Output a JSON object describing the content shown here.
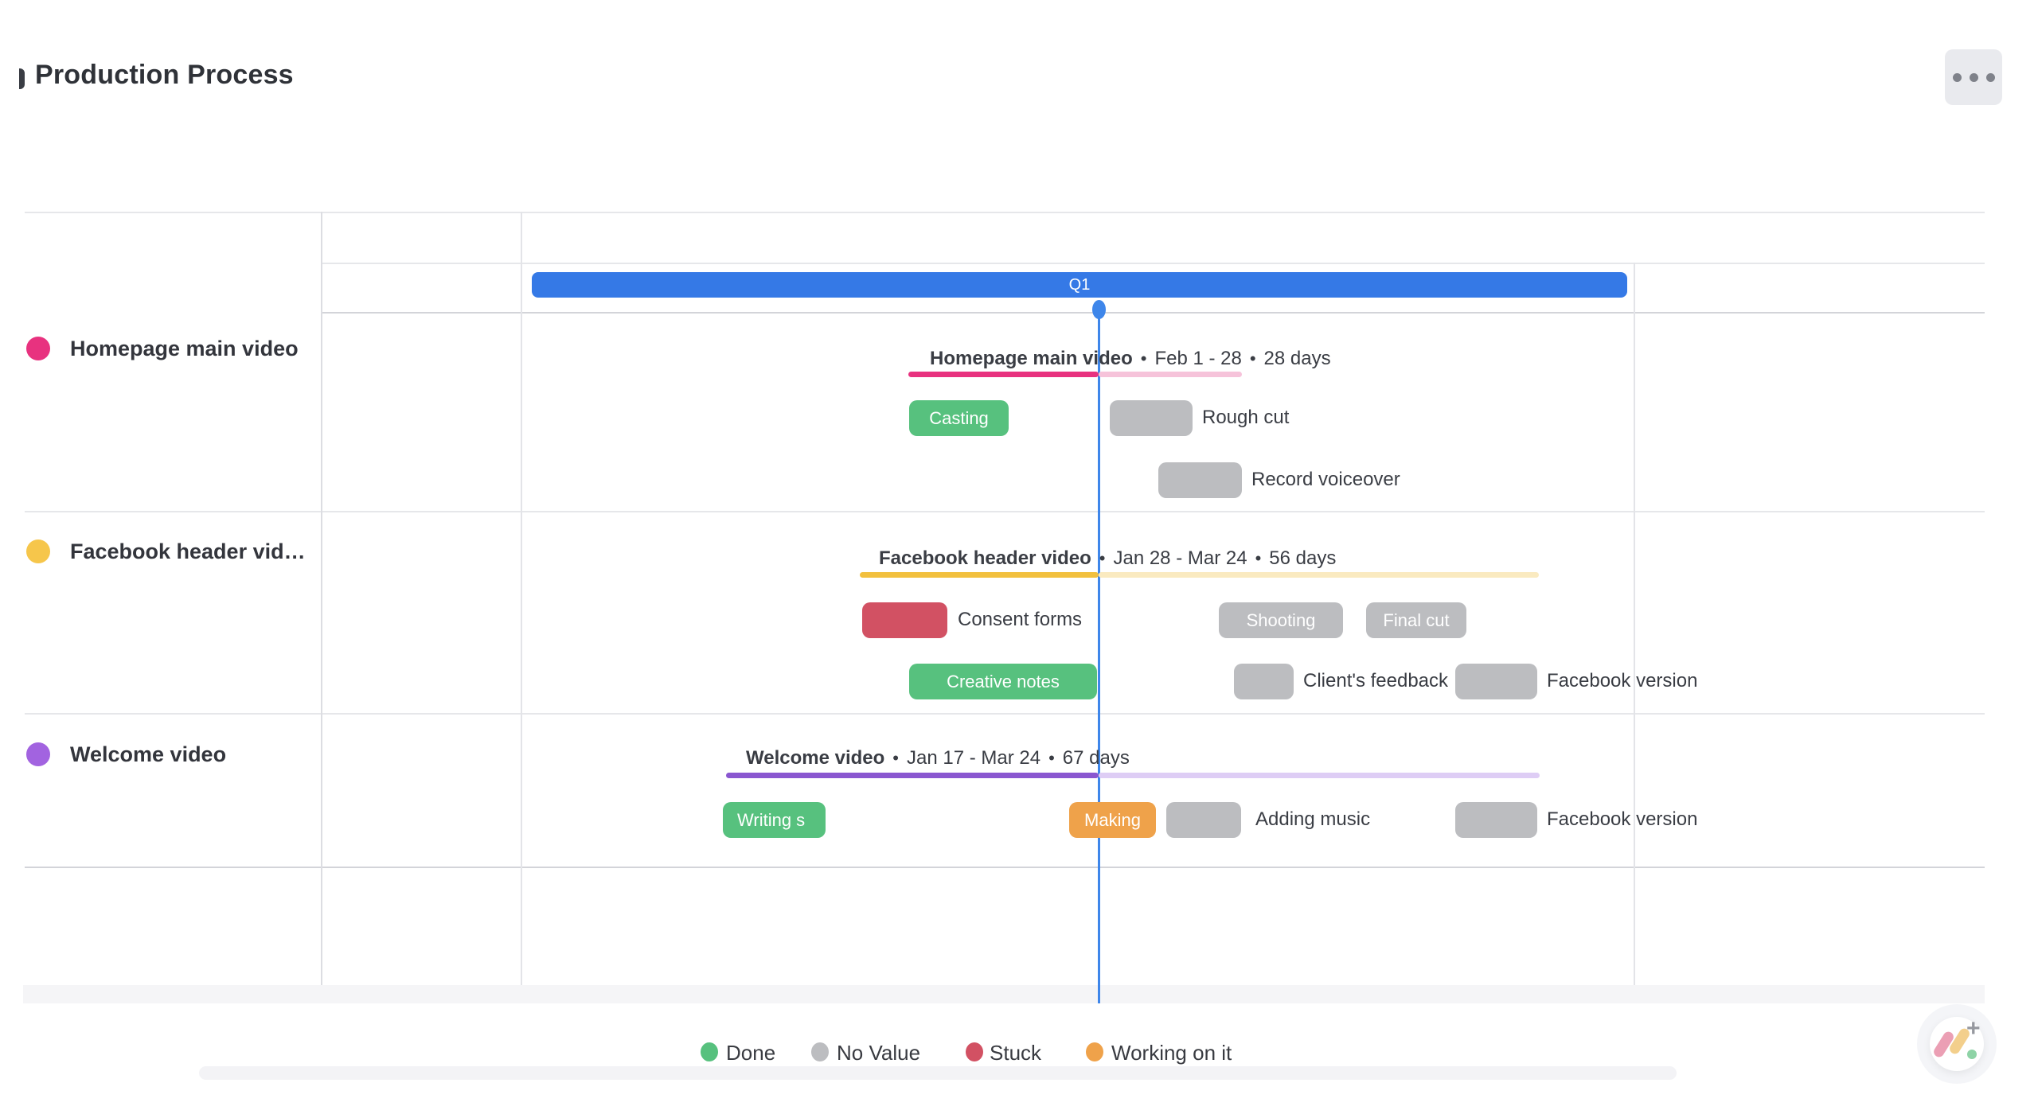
{
  "ui": {
    "bullet": "•"
  },
  "header": {
    "title": "Production Process",
    "menu_icon": "ellipsis-icon"
  },
  "timeline": {
    "quarter_label": "Q1"
  },
  "status_colors": {
    "done": "#57c17e",
    "no_value": "#bcbdc0",
    "stuck": "#d25163",
    "working_on_it": "#efa24a",
    "timeline_blue": "#3579e6",
    "today_line": "#3e86ea"
  },
  "rows": [
    {
      "sidebar_label": "Homepage main video",
      "color": "#e8327f",
      "group": {
        "name": "Homepage main video",
        "dates": "Feb 1 - 28",
        "duration": "28 days"
      },
      "tasks": [
        {
          "label": "Casting",
          "status": "done"
        },
        {
          "label": "Rough cut",
          "status": "no_value"
        },
        {
          "label": "Record voiceover",
          "status": "no_value"
        }
      ]
    },
    {
      "sidebar_label": "Facebook header vid…",
      "color": "#f6c64b",
      "group": {
        "name": "Facebook header video",
        "dates": "Jan 28 - Mar 24",
        "duration": "56 days"
      },
      "tasks": [
        {
          "label": "Consent forms",
          "status": "stuck"
        },
        {
          "label": "Shooting",
          "status": "no_value"
        },
        {
          "label": "Final cut",
          "status": "no_value"
        },
        {
          "label": "Creative notes",
          "status": "done"
        },
        {
          "label": "Client's feedback",
          "status": "no_value"
        },
        {
          "label": "Facebook version",
          "status": "no_value"
        }
      ]
    },
    {
      "sidebar_label": "Welcome video",
      "color": "#a263e0",
      "group": {
        "name": "Welcome video",
        "dates": "Jan 17 - Mar 24",
        "duration": "67 days"
      },
      "tasks": [
        {
          "label": "Writing s",
          "status": "done"
        },
        {
          "label": "Making",
          "status": "working_on_it"
        },
        {
          "label": "Adding music",
          "status": "no_value"
        },
        {
          "label": "Facebook version",
          "status": "no_value"
        }
      ]
    }
  ],
  "legend": {
    "items": [
      {
        "label": "Done",
        "color": "#57c17e"
      },
      {
        "label": "No Value",
        "color": "#bcbdc0"
      },
      {
        "label": "Stuck",
        "color": "#d25163"
      },
      {
        "label": "Working on it",
        "color": "#efa24a"
      }
    ]
  },
  "fab": {
    "plus": "+"
  }
}
